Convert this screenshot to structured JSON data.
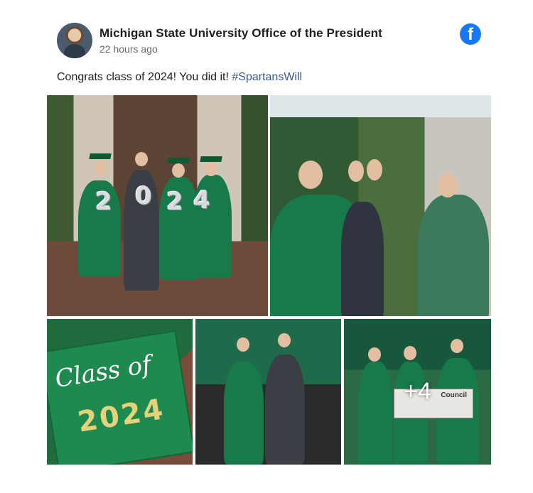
{
  "header": {
    "page_name": "Michigan State University Office of the President",
    "timestamp": "22 hours ago",
    "platform_icon": "facebook-icon"
  },
  "post": {
    "caption_text": "Congrats class of 2024! You did it! ",
    "hashtag": "#SpartansWill"
  },
  "photos": {
    "balloon_digits": [
      "2",
      "0",
      "2",
      "4"
    ],
    "cap_script": "Class of",
    "cap_year": "2024",
    "more_count": "+4",
    "check_label": "Council"
  },
  "colors": {
    "facebook_blue": "#1877f2",
    "hashtag_blue": "#385898",
    "msu_green": "#177a4a"
  }
}
